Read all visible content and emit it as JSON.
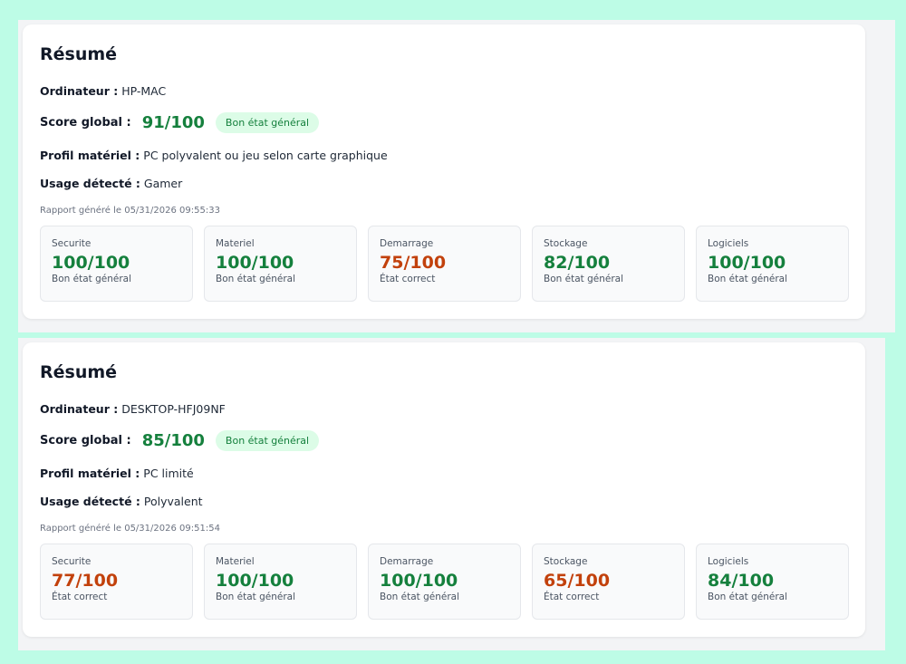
{
  "colors": {
    "good": "#15803d",
    "warn": "#c2410c",
    "badge_bg": "#dcfce7",
    "page_bg": "#bdfce6"
  },
  "reports": [
    {
      "title": "Résumé",
      "computer_label": "Ordinateur :",
      "computer": "HP-MAC",
      "score_label": "Score global :",
      "score": "91/100",
      "badge": "Bon état général",
      "profile_label": "Profil matériel :",
      "profile": "PC polyvalent ou jeu selon carte graphique",
      "usage_label": "Usage détecté :",
      "usage": "Gamer",
      "generated": "Rapport généré le 05/31/2026 09:55:33",
      "tiles": [
        {
          "name": "Securite",
          "score": "100/100",
          "status": "Bon état général",
          "level": "good"
        },
        {
          "name": "Materiel",
          "score": "100/100",
          "status": "Bon état général",
          "level": "good"
        },
        {
          "name": "Demarrage",
          "score": "75/100",
          "status": "État correct",
          "level": "warn"
        },
        {
          "name": "Stockage",
          "score": "82/100",
          "status": "Bon état général",
          "level": "good"
        },
        {
          "name": "Logiciels",
          "score": "100/100",
          "status": "Bon état général",
          "level": "good"
        }
      ]
    },
    {
      "title": "Résumé",
      "computer_label": "Ordinateur :",
      "computer": "DESKTOP-HFJ09NF",
      "score_label": "Score global :",
      "score": "85/100",
      "badge": "Bon état général",
      "profile_label": "Profil matériel :",
      "profile": "PC limité",
      "usage_label": "Usage détecté :",
      "usage": "Polyvalent",
      "generated": "Rapport généré le 05/31/2026 09:51:54",
      "tiles": [
        {
          "name": "Securite",
          "score": "77/100",
          "status": "État correct",
          "level": "warn"
        },
        {
          "name": "Materiel",
          "score": "100/100",
          "status": "Bon état général",
          "level": "good"
        },
        {
          "name": "Demarrage",
          "score": "100/100",
          "status": "Bon état général",
          "level": "good"
        },
        {
          "name": "Stockage",
          "score": "65/100",
          "status": "État correct",
          "level": "warn"
        },
        {
          "name": "Logiciels",
          "score": "84/100",
          "status": "Bon état général",
          "level": "good"
        }
      ]
    }
  ]
}
